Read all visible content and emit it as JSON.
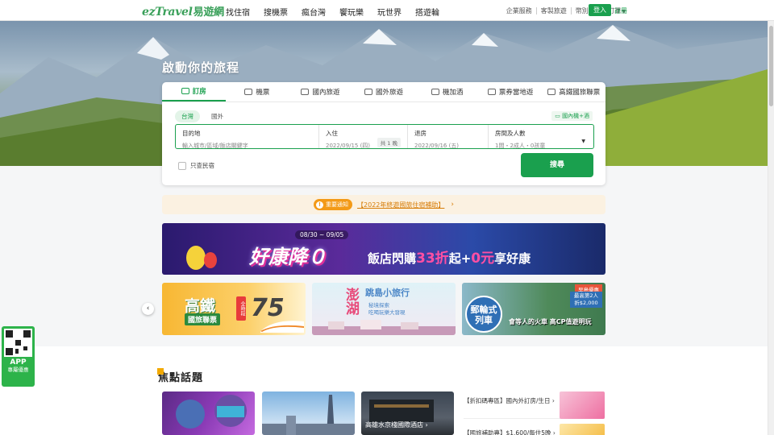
{
  "header": {
    "logo_en": "ezTravel",
    "logo_zh": "易遊網",
    "nav": [
      "找住宿",
      "搜機票",
      "瘋台灣",
      "饗玩樂",
      "玩世界",
      "搭遊輪"
    ],
    "util": [
      "企業服務",
      "客製旅遊",
      "幣別",
      "查訂單"
    ],
    "login": "登入",
    "register": "註冊"
  },
  "hero": {
    "title": "啟動你的旅程"
  },
  "search": {
    "tabs": [
      "訂房",
      "機票",
      "國內旅遊",
      "國外旅遊",
      "機加酒",
      "票券當地遊",
      "高鐵國旅聯票"
    ],
    "active_tab": "訂房",
    "subtabs": [
      "台灣",
      "國外"
    ],
    "compare": "國內機+酒",
    "fields": {
      "destination_label": "目的地",
      "destination_placeholder": "輸入城市/區域/飯店關鍵字",
      "checkin_label": "入住",
      "checkin_value": "2022/09/15 (四)",
      "nights": "共 1 晚",
      "checkout_label": "退房",
      "checkout_value": "2022/09/16 (五)",
      "rooms_label": "房間及人數",
      "rooms_value": "1間・2成人・0孩童"
    },
    "only_bnb": "只查民宿",
    "submit": "搜尋"
  },
  "notice": {
    "badge": "重要通知",
    "link": "【2022年終遊國旅住宿補助】"
  },
  "banner": {
    "date": "08/30 ~ 09/05",
    "big": "好康降０",
    "sub_pre": "飯店閃購",
    "sub_em": "33折",
    "sub_mid": "起+",
    "sub_em2": "0元",
    "sub_post": "享好康"
  },
  "cards": {
    "c1": {
      "title": "高鐵",
      "sub": "國旅聯票",
      "tag": "全時段",
      "num": "75"
    },
    "c2": {
      "title": "澎湖",
      "title2": "跳島小旅行",
      "desc1": "秘境探索",
      "desc2": "吃喝玩樂大發現"
    },
    "c3": {
      "badge": "早鳥優惠",
      "circle": "郵輪式列車",
      "price": "最高第2人折$2,000",
      "slogan": "會等人的火車 高CP值遊明玩"
    }
  },
  "focus": {
    "title": "焦點話題",
    "tile3_caption": "高雄水京棧國際酒店 ›",
    "promo1": "【折扣碼專區】國內外訂房/生日 ›",
    "promo2": "【國旅補助專】$1,600/每住5晚 ›"
  },
  "app": {
    "title": "APP",
    "sub": "專屬優惠"
  },
  "colors": {
    "brand": "#1aa04e",
    "notice": "#d77c06",
    "accent": "#f2a900"
  }
}
